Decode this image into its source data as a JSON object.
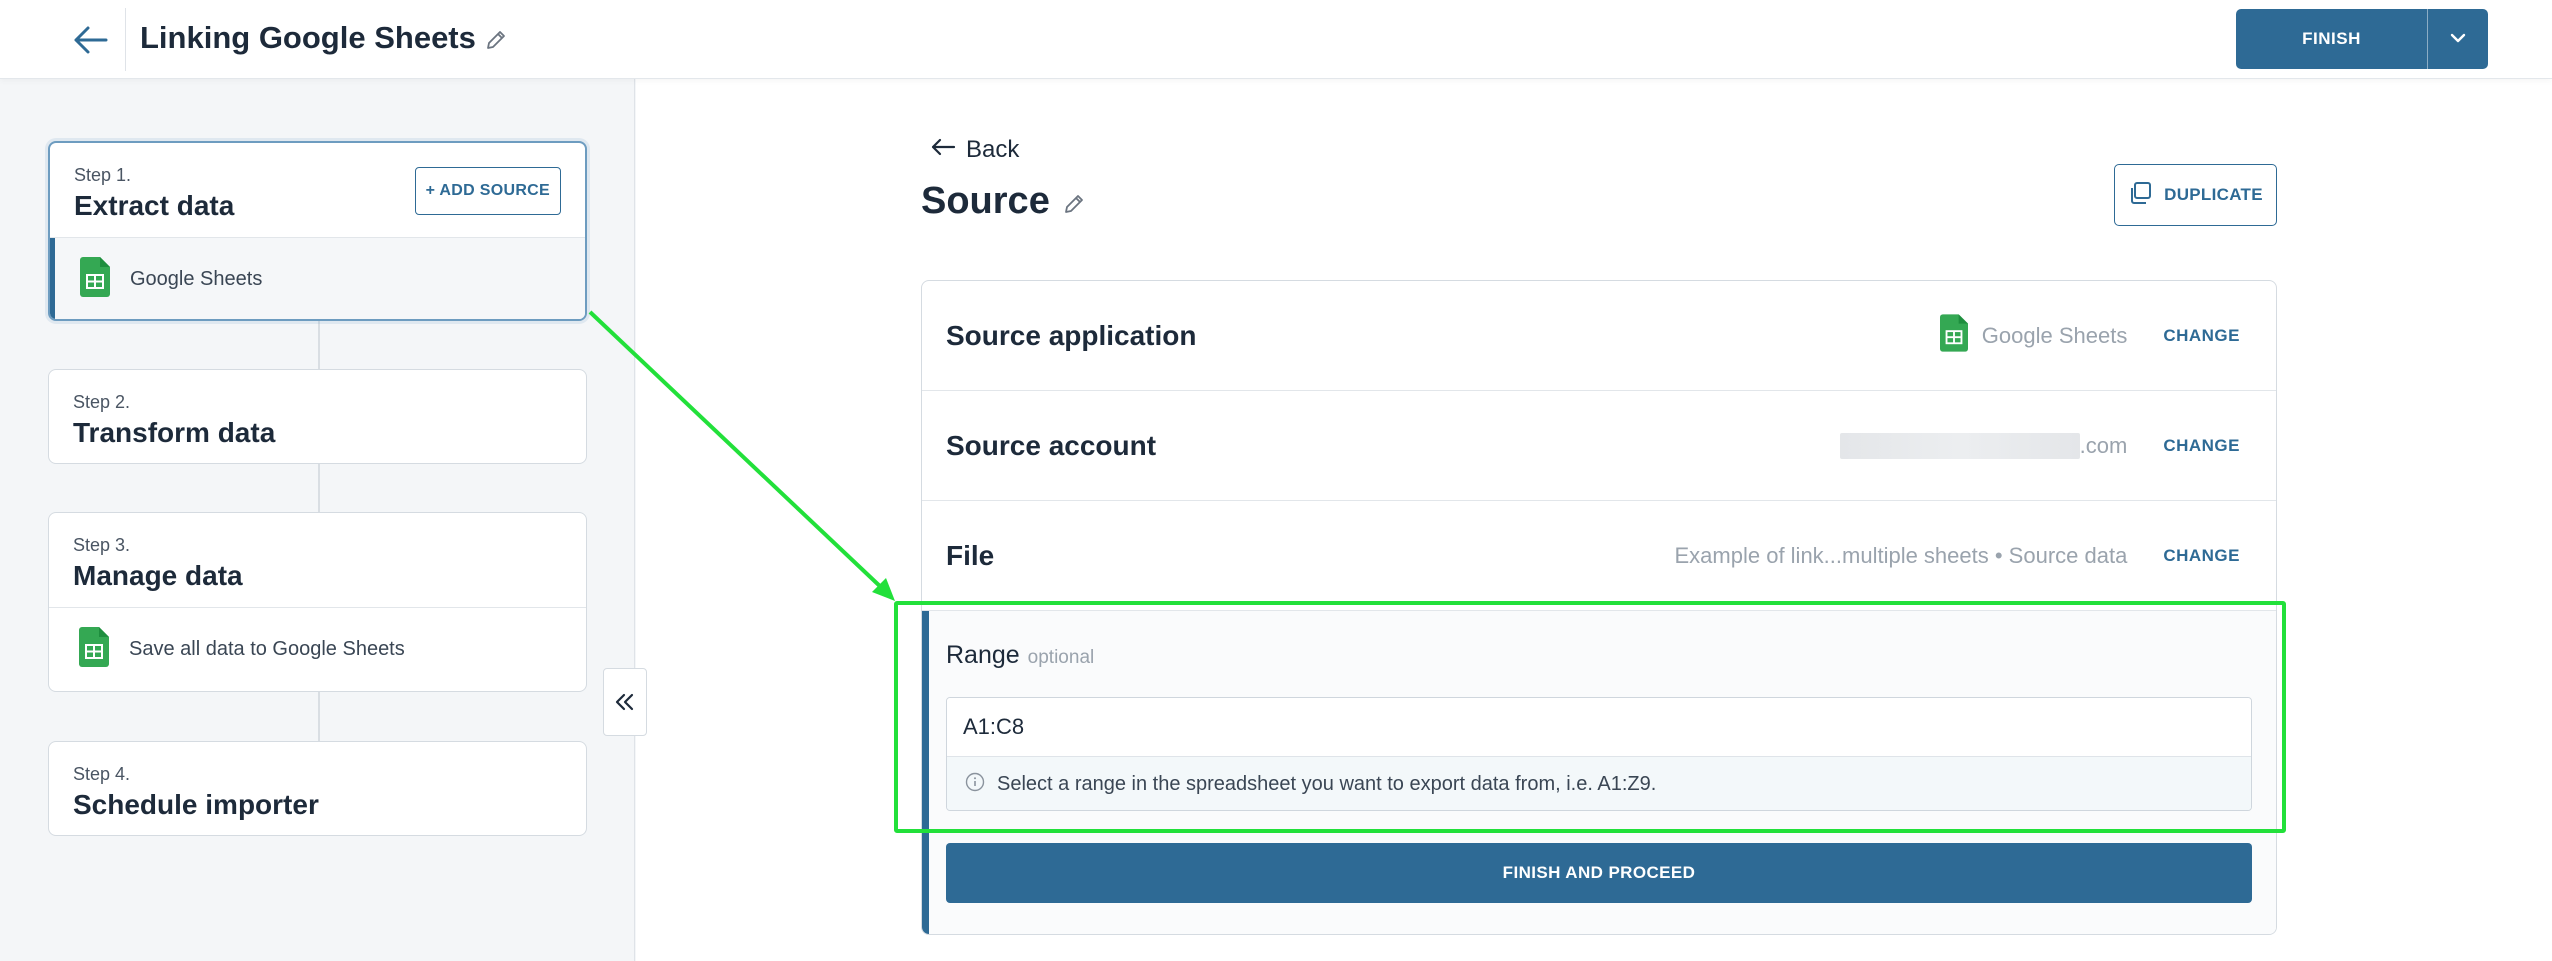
{
  "header": {
    "title": "Linking Google Sheets",
    "finish_label": "FINISH"
  },
  "steps": [
    {
      "label": "Step 1.",
      "name": "Extract data",
      "action": "+ ADD SOURCE",
      "item": "Google Sheets"
    },
    {
      "label": "Step 2.",
      "name": "Transform data"
    },
    {
      "label": "Step 3.",
      "name": "Manage data",
      "item": "Save all data to Google Sheets"
    },
    {
      "label": "Step 4.",
      "name": "Schedule importer"
    }
  ],
  "main": {
    "back_label": "Back",
    "title": "Source",
    "duplicate_label": "DUPLICATE",
    "rows": [
      {
        "label": "Source application",
        "value": "Google Sheets",
        "action": "CHANGE"
      },
      {
        "label": "Source account",
        "value": ".com",
        "action": "CHANGE"
      },
      {
        "label": "File",
        "value": "Example of link...multiple sheets • Source data",
        "action": "CHANGE"
      }
    ],
    "range": {
      "label": "Range",
      "optional": "optional",
      "value": "A1:C8",
      "hint": "Select a range in the spreadsheet you want to export data from, i.e. A1:Z9."
    },
    "proceed_label": "FINISH AND PROCEED"
  },
  "colors": {
    "accent": "#2e6a95",
    "sheets_green": "#34a853",
    "highlight": "#22e03a"
  },
  "icons": [
    "back-arrow-icon",
    "pencil-icon",
    "chevron-down-icon",
    "google-sheets-icon",
    "duplicate-icon",
    "info-icon",
    "double-chevron-left-icon"
  ]
}
